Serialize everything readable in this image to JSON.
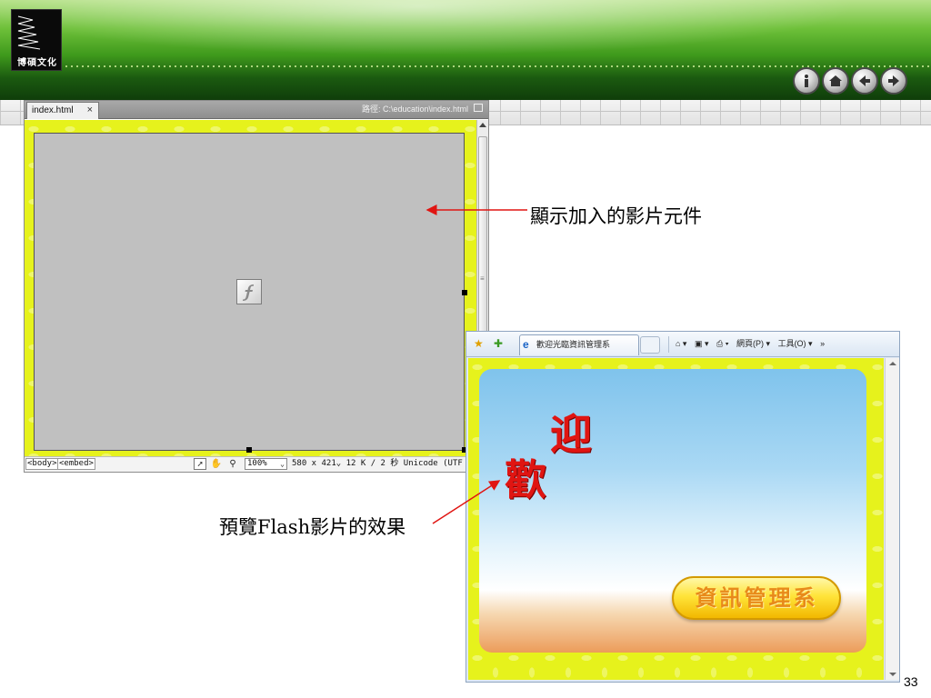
{
  "header": {
    "logo_text": "博碩文化",
    "nav_buttons": [
      "info-icon",
      "home-icon",
      "arrow-left-icon",
      "arrow-right-icon"
    ]
  },
  "editor": {
    "tab_label": "index.html",
    "tab_close": "×",
    "path": "路徑: C:\\education\\index.html",
    "status": {
      "tag_body": "<body>",
      "tag_embed": "<embed>",
      "zoom": "100%",
      "info": "580 x 421⌄ 12 K / 2 秒 Unicode (UTF"
    },
    "colors": {
      "page_background": "#e6f21c",
      "embed_background": "#c0c0c0"
    }
  },
  "callouts": {
    "embed_note": "顯示加入的影片元件",
    "preview_note": "預覽Flash影片的效果"
  },
  "browser": {
    "tab_title": "歡迎光臨資訊管理系",
    "commands": [
      "⌂ ▾",
      "▣ ▾",
      "⎙ ▾",
      "網頁(P) ▾",
      "工具(O) ▾",
      "»"
    ],
    "movie": {
      "char_1": "迎",
      "char_2": "歡",
      "badge": "資訊管理系"
    },
    "colors": {
      "headline": "#e01512",
      "badge": "#ffe43a"
    }
  },
  "page_number": "33"
}
